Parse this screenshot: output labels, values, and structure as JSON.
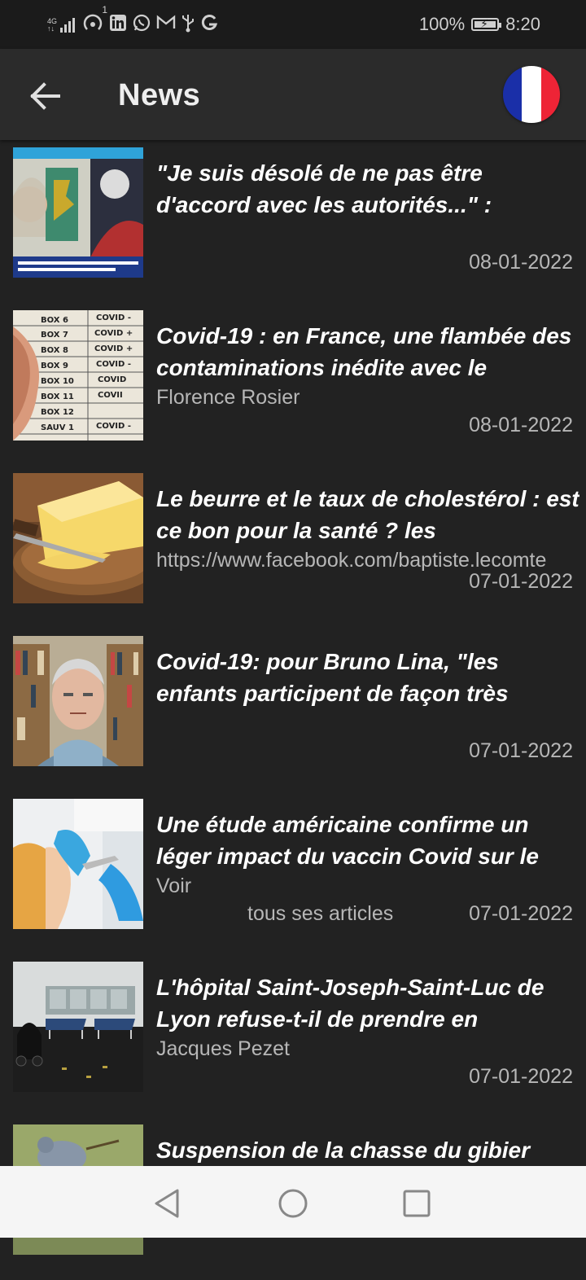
{
  "status_bar": {
    "network": "4G",
    "notif_count": "1",
    "battery_percent": "100%",
    "battery_level": 1.0,
    "time": "8:20",
    "icons": [
      "signal-icon",
      "hotspot-icon",
      "linkedin-icon",
      "whatsapp-icon",
      "gmail-icon",
      "usb-icon",
      "google-icon"
    ]
  },
  "app_bar": {
    "title": "News",
    "back_icon": "arrow-left-icon",
    "flag": "france-flag"
  },
  "articles": [
    {
      "headline": "\"Je suis désolé de ne pas être d'accord avec les autorités...\" :",
      "author": "",
      "date": "08-01-2022",
      "image": "tv-studio-debate"
    },
    {
      "headline": "Covid-19 : en France, une flambée des contaminations inédite avec le",
      "author": "Florence Rosier",
      "date": "08-01-2022",
      "image": "covid-test-boxes"
    },
    {
      "headline": "Le beurre et le taux de cholestérol : est ce bon pour la santé ? les",
      "author": "https://www.facebook.com/baptiste.lecomte",
      "date": "07-01-2022",
      "image": "butter-dish"
    },
    {
      "headline": "Covid-19: pour Bruno Lina, \"les enfants participent de façon très",
      "author": "",
      "date": "07-01-2022",
      "image": "man-portrait-bookshelf"
    },
    {
      "headline": "Une étude américaine confirme un léger impact du vaccin Covid sur le",
      "author": "Voir",
      "author_line2": "tous ses articles",
      "date": "07-01-2022",
      "image": "vaccine-injection"
    },
    {
      "headline": "L'hôpital Saint-Joseph-Saint-Luc de Lyon refuse-t-il de prendre en",
      "author": "Jacques Pezet",
      "date": "07-01-2022",
      "image": "hospital-room"
    },
    {
      "headline": "Suspension de la chasse du gibier",
      "author": "",
      "date": "",
      "image": "pigeon-bird"
    }
  ],
  "nav_bar": {
    "back": "nav-back-icon",
    "home": "nav-home-icon",
    "recents": "nav-recents-icon"
  }
}
